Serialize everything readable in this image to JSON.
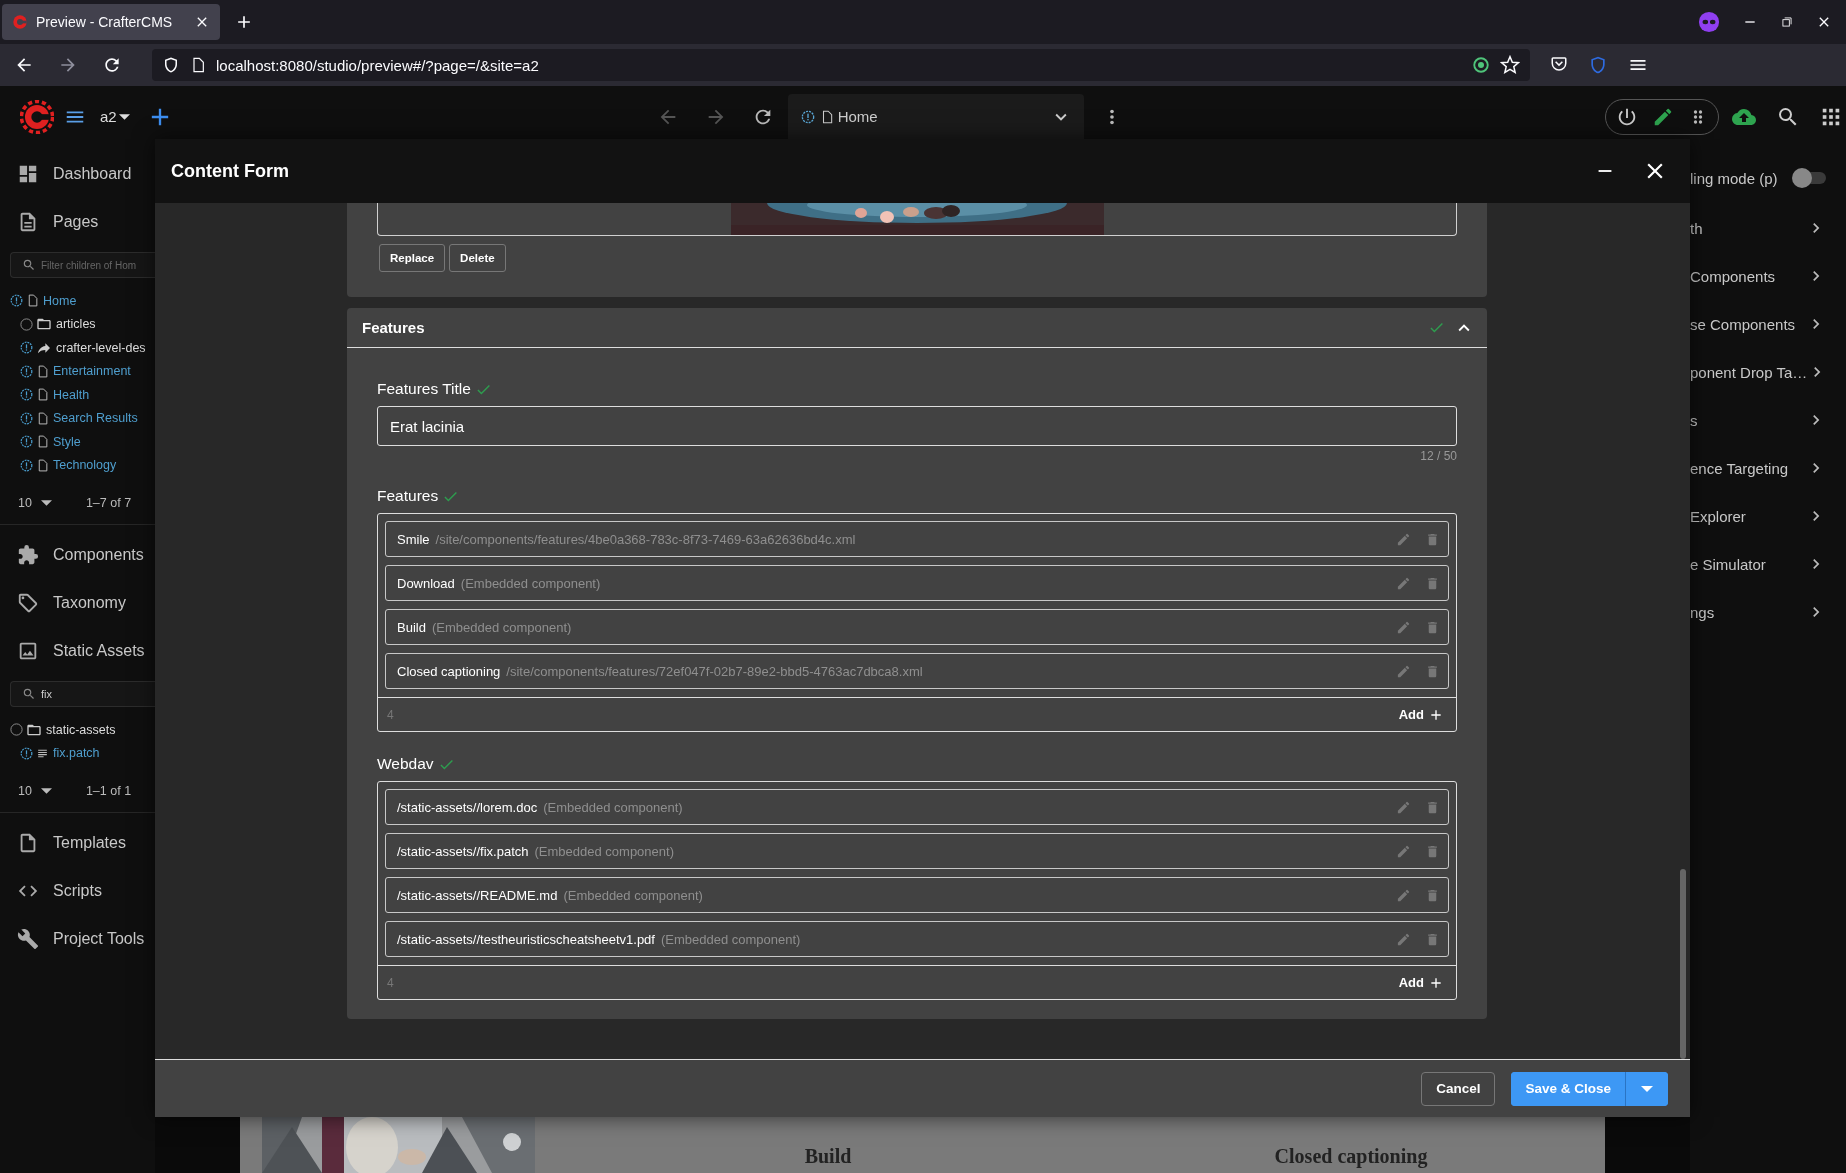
{
  "browser": {
    "tab_title": "Preview - CrafterCMS",
    "url": "localhost:8080/studio/preview#/?page=/&site=a2"
  },
  "toolbar": {
    "site": "a2",
    "address": "Home"
  },
  "sidebar": [
    {
      "kind": "nav",
      "label": "Dashboard"
    },
    {
      "kind": "nav",
      "label": "Pages"
    },
    {
      "kind": "filter",
      "placeholder": "Filter children of Hom"
    },
    {
      "kind": "tree",
      "items": [
        {
          "kind": "page",
          "label": "Home",
          "children": [
            {
              "kind": "folder",
              "label": "articles"
            },
            {
              "kind": "shared",
              "label": "crafter-level-des"
            },
            {
              "kind": "page",
              "label": "Entertainment"
            },
            {
              "kind": "page",
              "label": "Health"
            },
            {
              "kind": "page",
              "label": "Search Results"
            },
            {
              "kind": "page",
              "label": "Style"
            },
            {
              "kind": "page",
              "label": "Technology"
            }
          ]
        }
      ]
    },
    {
      "kind": "pager",
      "page_size": "10",
      "range": "1–7 of 7"
    },
    {
      "kind": "nav",
      "label": "Components"
    },
    {
      "kind": "nav",
      "label": "Taxonomy"
    },
    {
      "kind": "nav",
      "label": "Static Assets"
    },
    {
      "kind": "filter",
      "value": "fix"
    },
    {
      "kind": "tree",
      "items": [
        {
          "kind": "folder",
          "label": "static-assets",
          "children": [
            {
              "kind": "file",
              "label": "fix.patch"
            }
          ]
        }
      ]
    },
    {
      "kind": "pager",
      "page_size": "10",
      "range": "1–1 of 1"
    },
    {
      "kind": "nav",
      "label": "Templates"
    },
    {
      "kind": "nav",
      "label": "Scripts"
    },
    {
      "kind": "nav",
      "label": "Project Tools"
    }
  ],
  "right_panel": {
    "toggle": {
      "label": "ling mode (p)",
      "on": false
    },
    "items": [
      "th",
      "Components",
      "se Components",
      "ponent Drop Ta…",
      "s",
      "ence Targeting",
      "Explorer",
      "e Simulator",
      "ngs"
    ]
  },
  "preview": {
    "headings": [
      "Build",
      "Closed captioning"
    ]
  },
  "dialog": {
    "title": "Content Form",
    "media": {
      "kind": "picture",
      "buttons": [
        "Replace",
        "Delete"
      ]
    },
    "sections": [
      {
        "title": "Features",
        "valid": true,
        "expanded": true,
        "fields": [
          {
            "kind": "text",
            "label": "Features Title",
            "valid": true,
            "value": "Erat lacinia",
            "counter": "12 / 50"
          },
          {
            "kind": "list",
            "label": "Features",
            "valid": true,
            "count": "4",
            "add_label": "Add",
            "items": [
              {
                "name": "Smile",
                "detail": "/site/components/features/4be0a368-783c-8f73-7469-63a62636bd4c.xml"
              },
              {
                "name": "Download",
                "detail": "(Embedded component)"
              },
              {
                "name": "Build",
                "detail": "(Embedded component)"
              },
              {
                "name": "Closed captioning",
                "detail": "/site/components/features/72ef047f-02b7-89e2-bbd5-4763ac7dbca8.xml"
              }
            ]
          },
          {
            "kind": "list",
            "label": "Webdav",
            "valid": true,
            "count": "4",
            "add_label": "Add",
            "items": [
              {
                "name": "/static-assets//lorem.doc",
                "detail": "(Embedded component)"
              },
              {
                "name": "/static-assets//fix.patch",
                "detail": "(Embedded component)"
              },
              {
                "name": "/static-assets//README.md",
                "detail": "(Embedded component)"
              },
              {
                "name": "/static-assets//testheuristicscheatsheetv1.pdf",
                "detail": "(Embedded component)"
              }
            ]
          }
        ]
      }
    ],
    "footer": {
      "cancel": "Cancel",
      "save": "Save & Close"
    }
  }
}
